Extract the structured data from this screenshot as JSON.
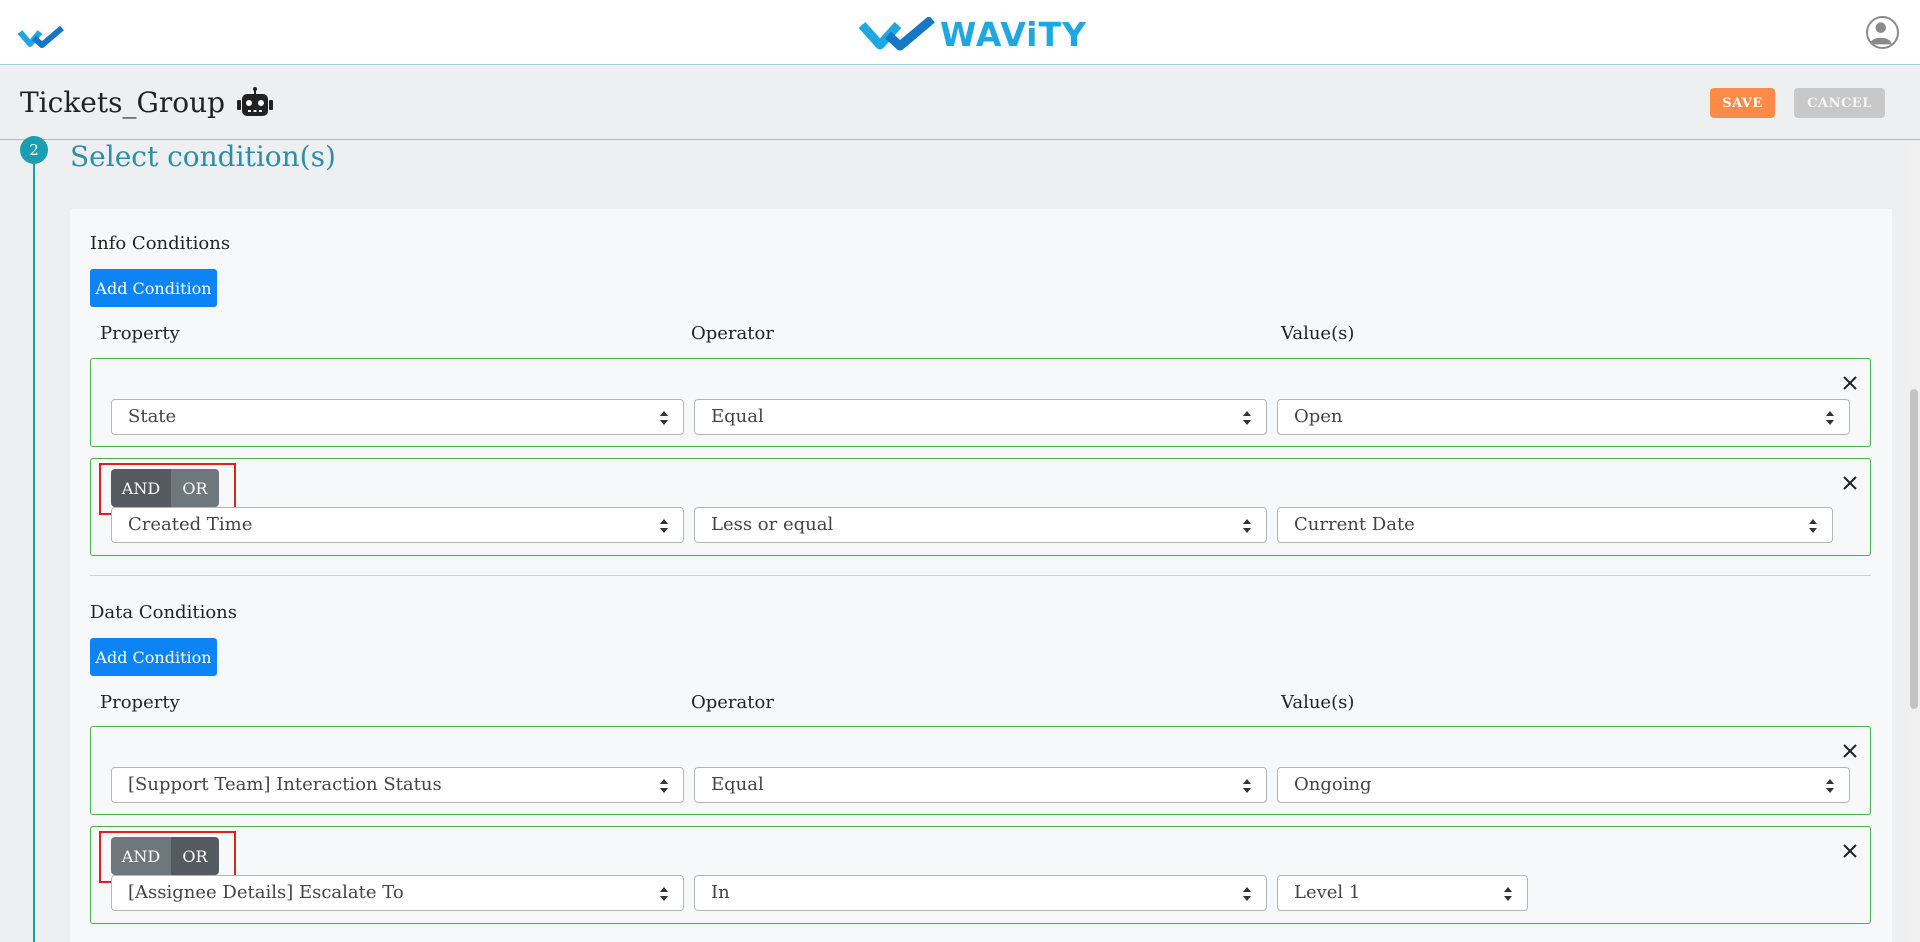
{
  "app": {
    "brand_name": "WAViTY"
  },
  "header": {
    "title": "Tickets_Group",
    "save_label": "SAVE",
    "cancel_label": "CANCEL"
  },
  "step": {
    "number": "2",
    "title": "Select condition(s)"
  },
  "info": {
    "label": "Info Conditions",
    "add_label": "Add Condition",
    "columns": {
      "property": "Property",
      "operator": "Operator",
      "values": "Value(s)"
    },
    "rows": [
      {
        "property": "State",
        "operator": "Equal",
        "value": "Open"
      },
      {
        "join_and": "AND",
        "join_or": "OR",
        "property": "Created Time",
        "operator": "Less or equal",
        "value": "Current Date"
      }
    ]
  },
  "data": {
    "label": "Data Conditions",
    "add_label": "Add Condition",
    "columns": {
      "property": "Property",
      "operator": "Operator",
      "values": "Value(s)"
    },
    "rows": [
      {
        "property": "[Support Team] Interaction Status",
        "operator": "Equal",
        "value": "Ongoing"
      },
      {
        "join_and": "AND",
        "join_or": "OR",
        "property": "[Assignee Details] Escalate To",
        "operator": "In",
        "value": "Level 1"
      }
    ]
  },
  "colors": {
    "accent": "#1b9fb0",
    "save": "#fb8b46",
    "primary_button": "#0d84f5",
    "condition_border": "#4caf50",
    "highlight": "#e02020"
  },
  "icons": {
    "logo_mark": "wavity-check-icon",
    "avatar": "user-avatar-icon",
    "bot": "robot-icon",
    "remove": "close-icon",
    "select": "sort-arrows-icon"
  }
}
